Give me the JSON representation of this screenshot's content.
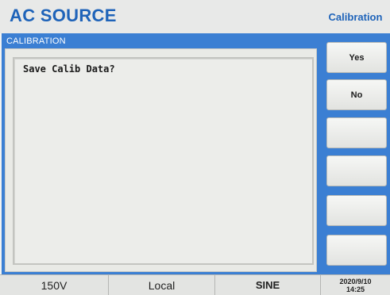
{
  "header": {
    "title": "AC SOURCE",
    "mode": "Calibration"
  },
  "panel": {
    "title": "CALIBRATION",
    "message": "Save Calib Data?"
  },
  "softkeys": [
    "Yes",
    "No",
    "",
    "",
    "",
    ""
  ],
  "status": {
    "voltage_range": "150V",
    "control": "Local",
    "waveform": "SINE",
    "date": "2020/9/10",
    "time": "14:25"
  },
  "colors": {
    "accent": "#3b7fd3",
    "title_text": "#1e63b9",
    "background": "#f2f3f2"
  }
}
